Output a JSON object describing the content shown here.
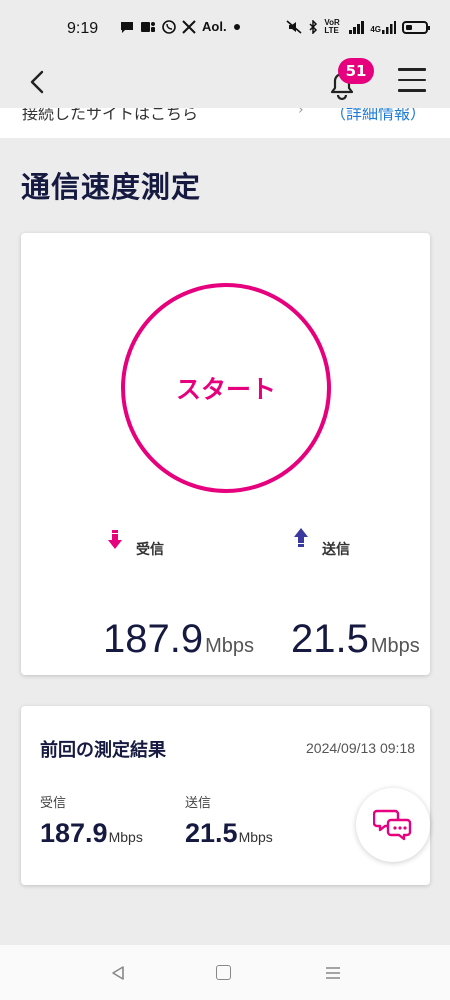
{
  "status_bar": {
    "time": "9:19",
    "left_icons": [
      "chat-bubble-icon",
      "teams-icon",
      "viber-icon",
      "x-icon",
      "aol-icon",
      "dot-icon"
    ],
    "right_icons": [
      "mute-icon",
      "bluetooth-icon",
      "volte-icon",
      "signal-icon",
      "signal-4g-icon",
      "battery-icon"
    ],
    "aol_text": "Aol.",
    "volte_text": "VoR LTE",
    "net_text": "4G"
  },
  "header": {
    "notification_count": "51"
  },
  "clipped_strip": {
    "text_left": "接続したサイトはこちら",
    "text_right": "（詳細情報）"
  },
  "page": {
    "title": "通信速度測定"
  },
  "speed_card": {
    "start_label": "スタート",
    "download_label": "受信",
    "upload_label": "送信",
    "download_value": "187.9",
    "upload_value": "21.5",
    "unit": "Mbps"
  },
  "result_card": {
    "title": "前回の測定結果",
    "date": "2024/09/13 09:18",
    "download_label": "受信",
    "upload_label": "送信",
    "download_value": "187.9",
    "upload_value": "21.5",
    "unit": "Mbps"
  },
  "colors": {
    "accent": "#e6007e",
    "upload_icon": "#3a3a9e",
    "text_dark": "#161a40",
    "background": "#ececec"
  }
}
